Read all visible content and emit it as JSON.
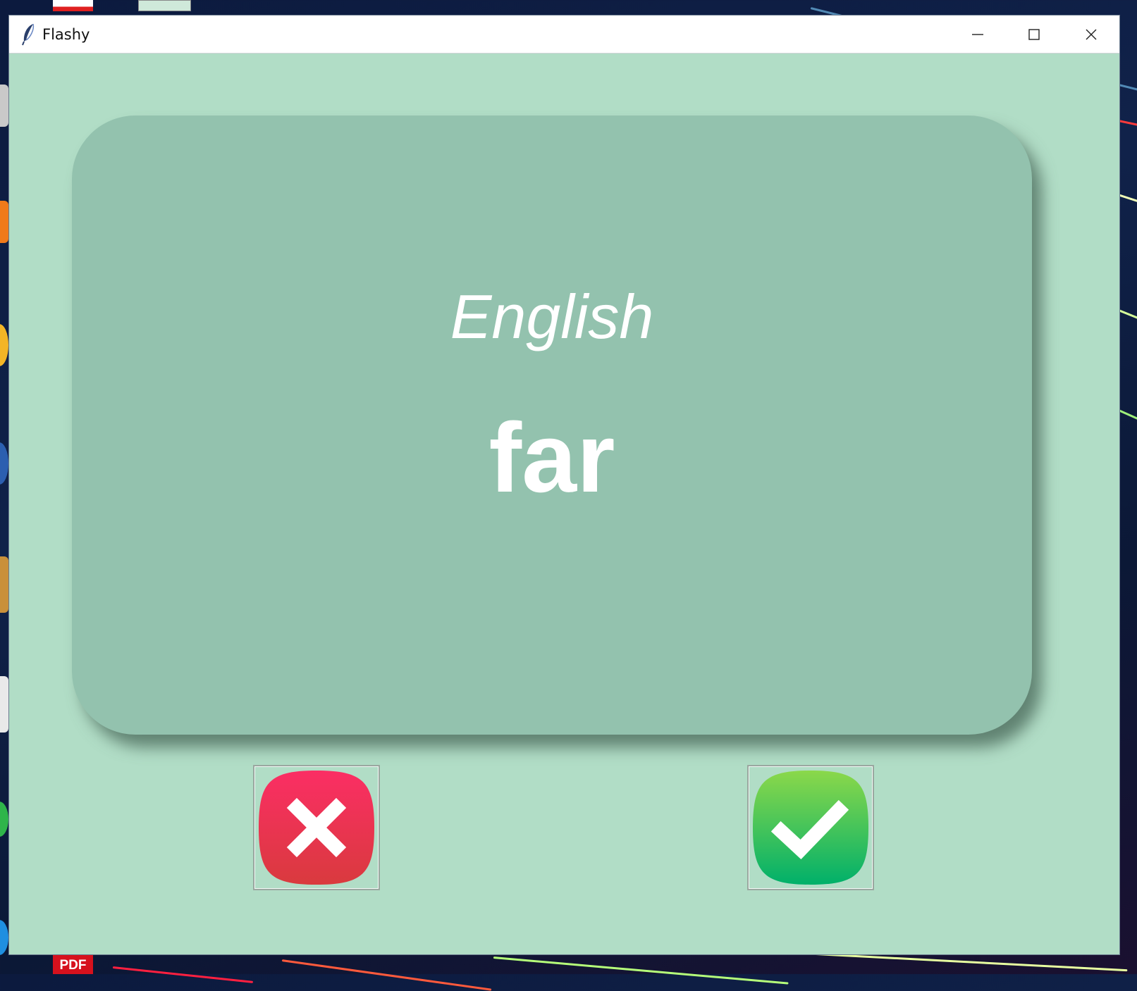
{
  "window": {
    "title": "Flashy",
    "app_icon": "feather-icon",
    "controls": [
      "minimize-icon",
      "maximize-icon",
      "close-icon"
    ]
  },
  "card": {
    "language": "English",
    "word": "far"
  },
  "buttons": {
    "wrong_icon": "x-icon",
    "right_icon": "check-icon"
  },
  "desktop": {
    "pdf_label": "PDF"
  },
  "colors": {
    "window_background": "#b1ddc6",
    "card_background": "#93c2ae",
    "card_text": "#ffffff",
    "wrong_button": "#e93559",
    "right_button": "#22b85c"
  }
}
